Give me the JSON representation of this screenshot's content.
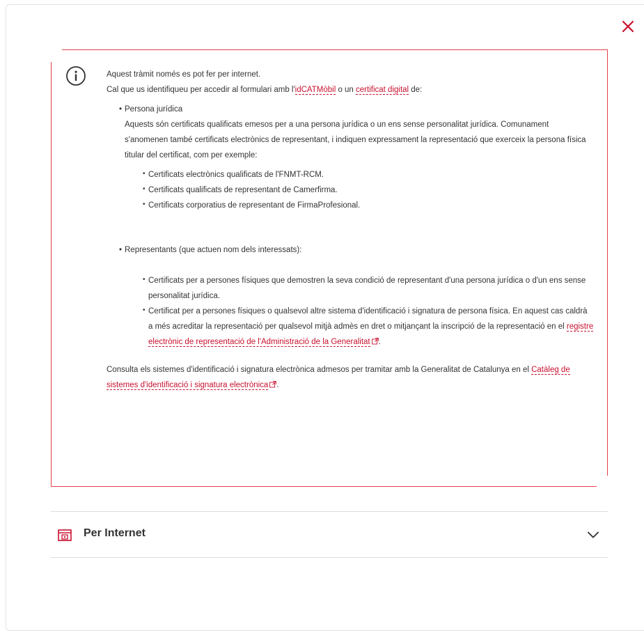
{
  "info": {
    "line1": "Aquest tràmit només es pot fer per internet.",
    "line2_pre": "Cal que us identifiqueu per accedir al formulari amb l'",
    "link_idcat": "idCATMòbil",
    "line2_mid": " o un ",
    "link_cert": "certificat digital",
    "line2_post": " de:",
    "juridica": {
      "title": "Persona jurídica",
      "desc": "Aquests són certificats qualificats emesos per a una persona jurídica o un ens sense personalitat jurídica. Comunament s'anomenen també certificats electrònics de representant, i indiquen expressament la representació que exerceix la persona física titular del certificat, com per exemple:",
      "items": [
        "Certificats electrònics qualificats de l'FNMT-RCM.",
        "Certificats qualificats de representant de Camerfirma.",
        "Certificats corporatius de representant de FirmaProfesional."
      ]
    },
    "representants": {
      "title": "Representants (que actuen nom dels interessats):",
      "item1": "Certificats per a persones físiques que demostren la seva condició de representant d'una persona jurídica o d'un ens sense personalitat jurídica.",
      "item2_pre": "Certificat per a persones físiques o qualsevol altre sistema d'identificació i signatura de persona física. En aquest cas caldrà a més acreditar la representació per qualsevol mitjà admès en dret o mitjançant la inscripció de la representació en el ",
      "item2_link": "registre electrònic de representació de l'Administració de la Generalitat",
      "item2_post": "."
    },
    "consulta_pre": "Consulta els sistemes d'identificació i signatura electrònica admesos per tramitar amb la Generalitat de Catalunya en el ",
    "consulta_link": "Catàleg de sistemes d'identificació i signatura electrònica",
    "consulta_post": "."
  },
  "accordion": {
    "title": "Per Internet"
  },
  "colors": {
    "accent": "#c8102e",
    "border": "#e0404a"
  },
  "icons": {
    "close": "close-icon",
    "info": "info-icon",
    "external": "external-link-icon",
    "channel": "computer-icon",
    "chevron": "chevron-down-icon"
  }
}
